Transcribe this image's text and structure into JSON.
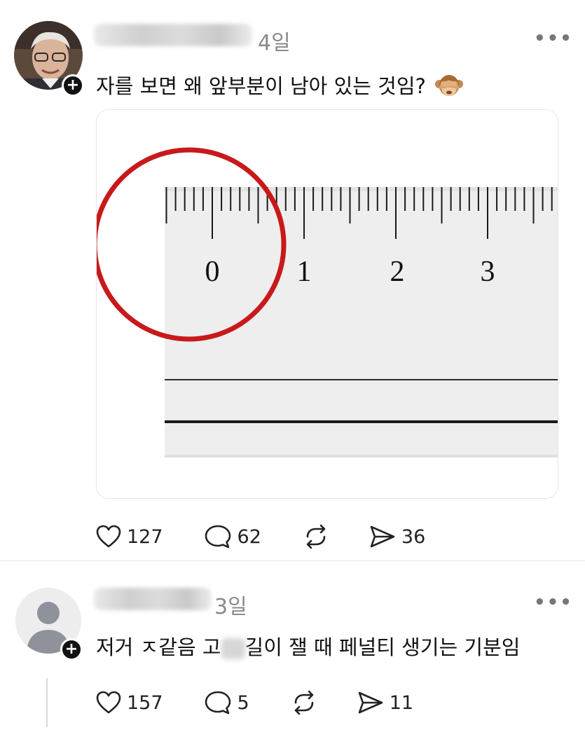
{
  "post": {
    "time": "4일",
    "more": "•••",
    "text": "자를 보면 왜 앞부분이 남아 있는 것임?",
    "emoji_icon": "see-no-evil-monkey-icon",
    "plus": "+",
    "image": {
      "ruler_labels": [
        "0",
        "1",
        "2",
        "3"
      ],
      "highlight_color": "#c8191b"
    },
    "actions": {
      "likes": "127",
      "replies": "62",
      "shares": "36"
    }
  },
  "reply": {
    "time": "3일",
    "more": "•••",
    "text_before": "저거 ㅈ같음 고",
    "text_after": "길이 잴 때 페널티 생기는 기분임",
    "plus": "+",
    "actions": {
      "likes": "157",
      "replies": "5",
      "shares": "11"
    }
  }
}
